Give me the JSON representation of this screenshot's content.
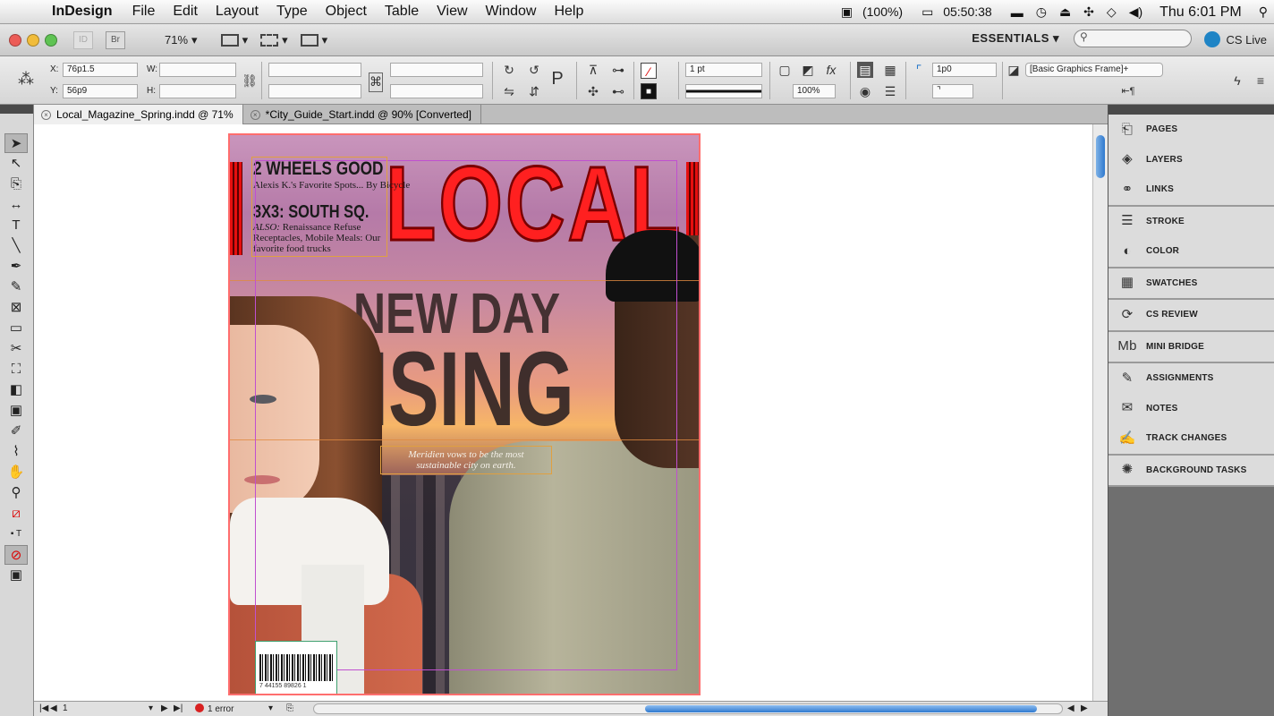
{
  "menubar": {
    "app_name": "InDesign",
    "menus": [
      "File",
      "Edit",
      "Layout",
      "Type",
      "Object",
      "Table",
      "View",
      "Window",
      "Help"
    ],
    "battery": "(100%)",
    "timer": "05:50:38",
    "clock": "Thu 6:01 PM"
  },
  "appbar": {
    "br_label": "Br",
    "zoom": "71%",
    "workspace": "ESSENTIALS ▾",
    "search_placeholder": "",
    "cs_live": "CS Live"
  },
  "control": {
    "x_label": "X:",
    "x_value": "76p1.5",
    "y_label": "Y:",
    "y_value": "56p9",
    "w_label": "W:",
    "w_value": "",
    "h_label": "H:",
    "h_value": "",
    "stroke_weight": "1 pt",
    "opacity": "100%",
    "offset": "1p0",
    "object_style": "[Basic Graphics Frame]+"
  },
  "tabs": [
    {
      "label": "Local_Magazine_Spring.indd @ 71%",
      "active": true
    },
    {
      "label": "*City_Guide_Start.indd @ 90% [Converted]",
      "active": false
    }
  ],
  "cover": {
    "masthead": "LOCAL",
    "line1": "2 WHEELS GOOD",
    "line2": "Alexis K.'s Favorite Spots... By Bicycle",
    "line3": "3X3: SOUTH SQ.",
    "line4_em": "ALSO:",
    "line4": "Renaissance Refuse Receptacles, Mobile Meals: Our favorite food trucks",
    "headline1": "NEW DAY",
    "headline2": "RISING",
    "tagline": "Meridien vows to be the most sustainable city on earth.",
    "barcode_num": "7 44155 89826 1"
  },
  "dock": {
    "groups": [
      [
        {
          "label": "PAGES",
          "icon": "pages-icon"
        },
        {
          "label": "LAYERS",
          "icon": "layers-icon"
        },
        {
          "label": "LINKS",
          "icon": "links-icon"
        }
      ],
      [
        {
          "label": "STROKE",
          "icon": "stroke-icon"
        },
        {
          "label": "COLOR",
          "icon": "color-icon"
        }
      ],
      [
        {
          "label": "SWATCHES",
          "icon": "swatches-icon"
        }
      ],
      [
        {
          "label": "CS REVIEW",
          "icon": "cs-review-icon"
        }
      ],
      [
        {
          "label": "MINI BRIDGE",
          "icon": "mini-bridge-icon"
        }
      ],
      [
        {
          "label": "ASSIGNMENTS",
          "icon": "assignments-icon"
        },
        {
          "label": "NOTES",
          "icon": "notes-icon"
        },
        {
          "label": "TRACK CHANGES",
          "icon": "track-changes-icon"
        }
      ],
      [
        {
          "label": "BACKGROUND TASKS",
          "icon": "background-tasks-icon"
        }
      ]
    ]
  },
  "status": {
    "page": "1",
    "errors": "1 error"
  },
  "colors": {
    "accent_blue": "#2f79cf",
    "masthead_red": "#ff2020",
    "error_red": "#d82020"
  }
}
